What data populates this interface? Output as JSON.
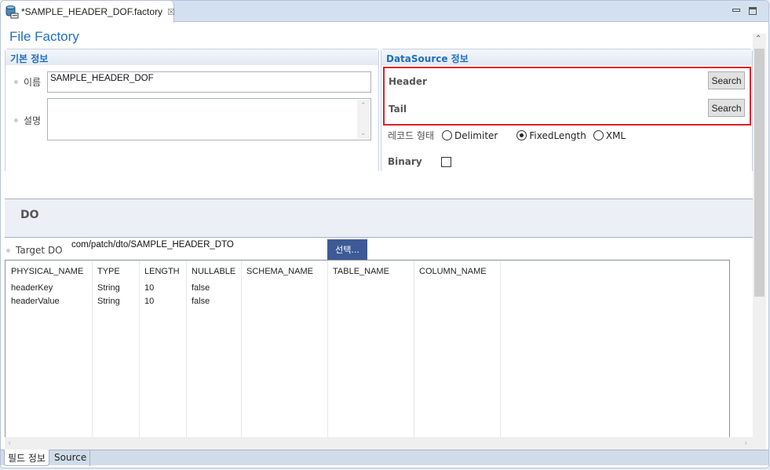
{
  "tab": {
    "title": "*SAMPLE_HEADER_DOF.factory",
    "icon": "database-icon",
    "close_glyph": "☒"
  },
  "window_controls": {
    "minimize": "minimize-icon",
    "maximize": "maximize-icon"
  },
  "page": {
    "title": "File Factory"
  },
  "basic_info": {
    "heading": "기본 정보",
    "name_label": "이름",
    "name_value": "SAMPLE_HEADER_DOF",
    "desc_label": "설명",
    "desc_value": ""
  },
  "datasource": {
    "heading": "DataSource 정보",
    "header_label": "Header",
    "header_button": "Search",
    "tail_label": "Tail",
    "tail_button": "Search",
    "record_type_label": "레코드 형태",
    "record_types": [
      {
        "label": "Delimiter",
        "checked": false
      },
      {
        "label": "FixedLength",
        "checked": true
      },
      {
        "label": "XML",
        "checked": false
      }
    ],
    "binary_label": "Binary",
    "binary_checked": false,
    "highlight_color": "#e0202a"
  },
  "do_section": {
    "title": "DO",
    "target_label": "Target DO",
    "target_value": "com/patch/dto/SAMPLE_HEADER_DTO",
    "select_button": "선택..."
  },
  "table": {
    "columns": [
      "PHYSICAL_NAME",
      "TYPE",
      "LENGTH",
      "NULLABLE",
      "SCHEMA_NAME",
      "TABLE_NAME",
      "COLUMN_NAME"
    ],
    "rows": [
      [
        "headerKey",
        "String",
        "10",
        "false",
        "",
        "",
        ""
      ],
      [
        "headerValue",
        "String",
        "10",
        "false",
        "",
        "",
        ""
      ]
    ]
  },
  "bottom_tabs": [
    {
      "label": "필드 정보",
      "active": true
    },
    {
      "label": "Source",
      "active": false
    }
  ]
}
